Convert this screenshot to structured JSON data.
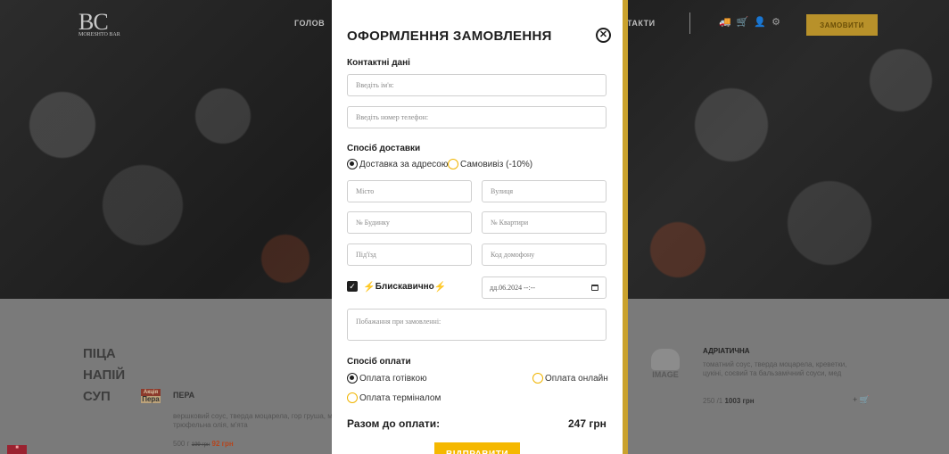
{
  "background": {
    "logo": "BC",
    "logo_sub": "MORESHTO BAR",
    "nav_left": "ГОЛОВ",
    "nav_right": "ТАКТИ",
    "order_button": "ЗАМОВИТИ",
    "categories": [
      "ПІЦА",
      "НАПІЙ",
      "СУП"
    ],
    "product_left": {
      "badge_top": "Акція",
      "badge_name": "Пера",
      "title": "ПЕРА",
      "description": "вершковий соус, тверда моцарела, гор груша, мед, трюфельна олія, м'ята",
      "weight": "500 г",
      "old_price": "199 грн",
      "price": "92 грн"
    },
    "product_right": {
      "noimage_label": "IMAGE",
      "title": "АДРІАТИЧНА",
      "description": "томатний соус, тверда моцарела, креветки, цукіні, соєвий та бальзамічний соуси, мед",
      "weight": "250 /1",
      "price": "1003 грн",
      "cart": "+ 🛒"
    },
    "icons": [
      "truck-icon",
      "cart-icon",
      "user-icon",
      "settings-icon"
    ]
  },
  "modal": {
    "title": "ОФОРМЛЕННЯ ЗАМОВЛЕННЯ",
    "close_symbol": "✕",
    "contacts_heading": "Контактні дані",
    "name_placeholder": "Введіть ім'я:",
    "phone_placeholder": "Введіть номер телефон:",
    "delivery_heading": "Спосіб доставки",
    "delivery_options": [
      {
        "label": "Доставка за адресою",
        "selected": true
      },
      {
        "label": "Самовивіз (-10%)",
        "selected": false
      }
    ],
    "address": {
      "city_placeholder": "Місто",
      "street_placeholder": "Вулиця",
      "house_placeholder": "№ Будинку",
      "apartment_placeholder": "№ Квартири",
      "entrance_placeholder": "Під'їзд",
      "intercom_placeholder": "Код домофону"
    },
    "fast_delivery": {
      "label": "Блискавично",
      "checked": true,
      "bolt": "⚡"
    },
    "datetime_value": "дд.06.2024 --:--",
    "wishes_placeholder": "Побажання при замовленні:",
    "payment_heading": "Спосіб оплати",
    "payment_options": [
      {
        "label": "Оплата готівкою",
        "selected": true
      },
      {
        "label": "Оплата онлайн",
        "selected": false
      },
      {
        "label": "Оплата терміналом",
        "selected": false
      }
    ],
    "total_label": "Разом до оплати:",
    "total_value": "247 грн",
    "submit_label": "ВІДПРАВИТИ"
  },
  "colors": {
    "accent": "#f5b800",
    "text": "#1e1e1e",
    "overlay": "#7a7a7a"
  }
}
